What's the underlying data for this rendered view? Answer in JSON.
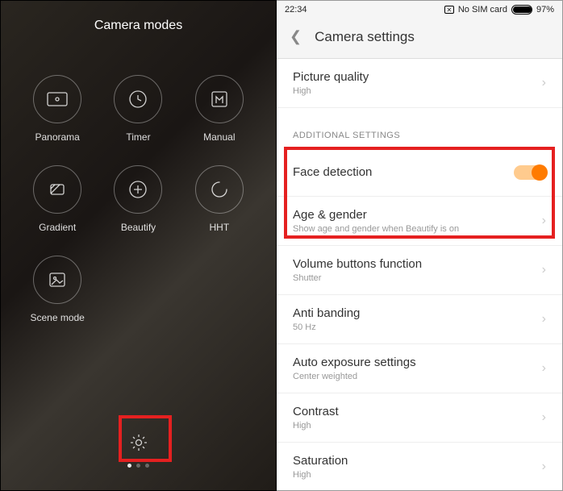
{
  "left": {
    "title": "Camera modes",
    "modes": {
      "panorama": "Panorama",
      "timer": "Timer",
      "manual": "Manual",
      "gradient": "Gradient",
      "beautify": "Beautify",
      "hht": "HHT",
      "scene": "Scene mode"
    }
  },
  "right": {
    "status": {
      "time": "22:34",
      "sim": "No SIM card",
      "battery": "97%"
    },
    "title": "Camera settings",
    "items": {
      "picq": {
        "title": "Picture quality",
        "sub": "High"
      },
      "section": "ADDITIONAL SETTINGS",
      "face": {
        "title": "Face detection"
      },
      "age": {
        "title": "Age & gender",
        "sub": "Show age and gender when Beautify is on"
      },
      "vol": {
        "title": "Volume buttons function",
        "sub": "Shutter"
      },
      "anti": {
        "title": "Anti banding",
        "sub": "50 Hz"
      },
      "auto": {
        "title": "Auto exposure settings",
        "sub": "Center weighted"
      },
      "contrast": {
        "title": "Contrast",
        "sub": "High"
      },
      "sat": {
        "title": "Saturation",
        "sub": "High"
      }
    }
  }
}
